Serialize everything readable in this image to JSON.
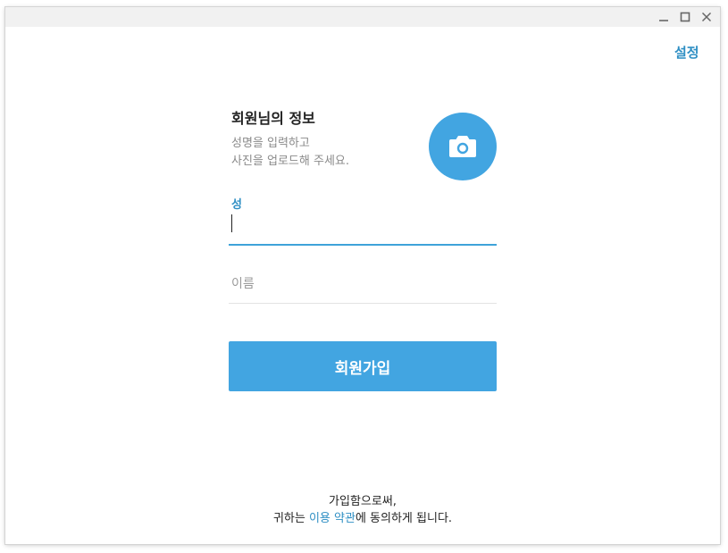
{
  "header": {
    "settings_label": "설정"
  },
  "profile": {
    "title": "회원님의 정보",
    "description_line1": "성명을 입력하고",
    "description_line2": "사진을 업로드해 주세요.",
    "photo_icon": "camera-icon"
  },
  "form": {
    "last_name_label": "성",
    "last_name_value": "",
    "first_name_placeholder": "이름",
    "signup_label": "회원가입"
  },
  "footer": {
    "line1": "가입함으로써,",
    "line2_prefix": "귀하는 ",
    "terms_link": "이용 약관",
    "line2_suffix": "에 동의하게 됩니다."
  },
  "colors": {
    "accent": "#42a5e1",
    "link": "#2f8fc4",
    "muted_text": "#8a8a8a",
    "titlebar": "#f1f1f1"
  }
}
